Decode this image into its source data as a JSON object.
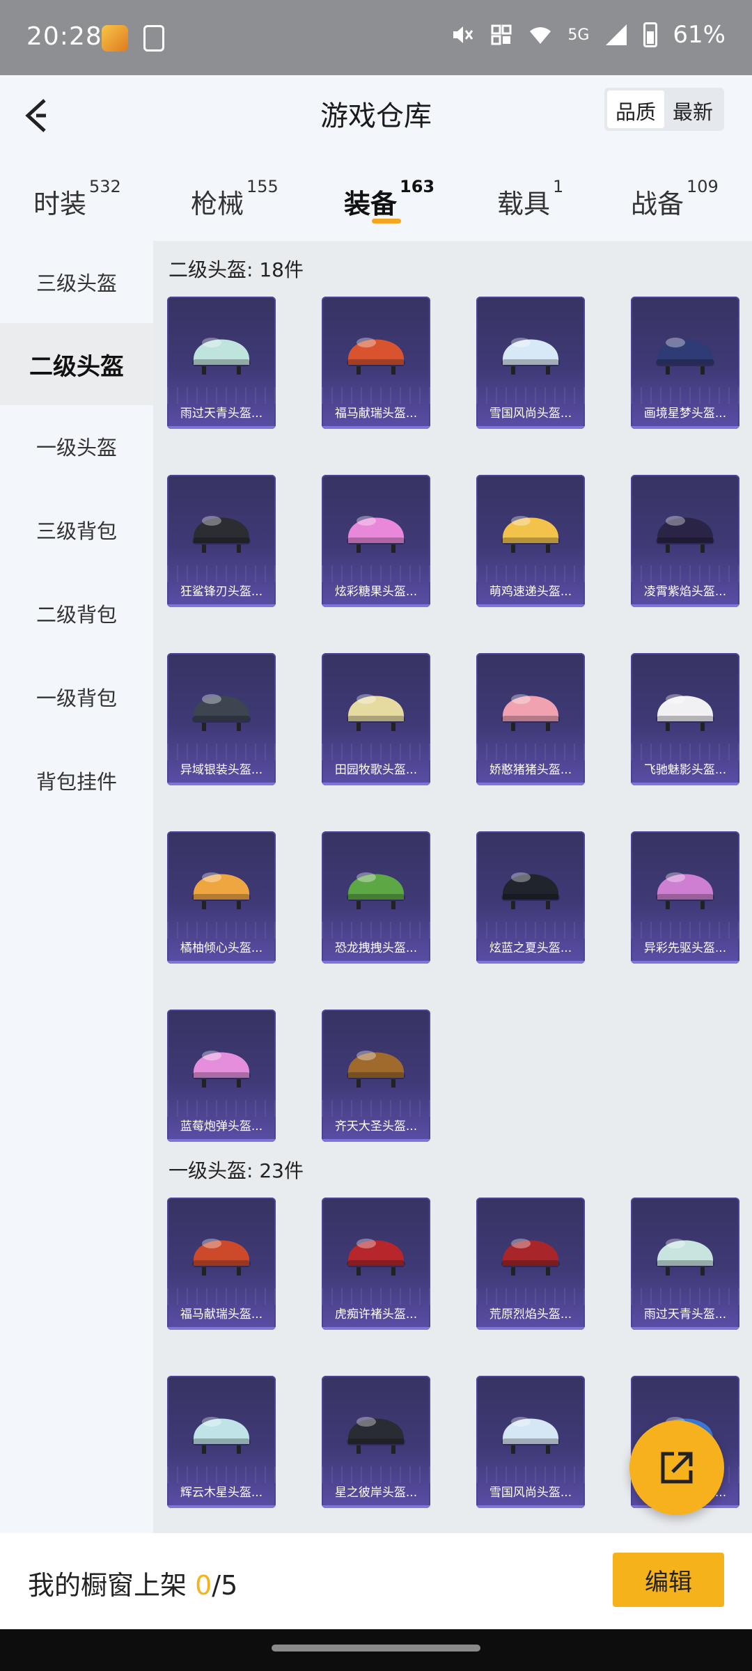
{
  "status_bar": {
    "time": "20:28",
    "network": "5G",
    "battery": "61%"
  },
  "header": {
    "title": "游戏仓库",
    "sort_options": [
      "品质",
      "最新"
    ],
    "selected_sort": "品质"
  },
  "tabs": [
    {
      "label": "时装",
      "count": "532"
    },
    {
      "label": "枪械",
      "count": "155"
    },
    {
      "label": "装备",
      "count": "163",
      "active": true
    },
    {
      "label": "载具",
      "count": "1"
    },
    {
      "label": "战备",
      "count": "109"
    }
  ],
  "sidebar": [
    {
      "label": "三级头盔"
    },
    {
      "label": "二级头盔",
      "active": true
    },
    {
      "label": "一级头盔"
    },
    {
      "label": "三级背包"
    },
    {
      "label": "二级背包"
    },
    {
      "label": "一级背包"
    },
    {
      "label": "背包挂件"
    }
  ],
  "sections": [
    {
      "title": "二级头盔: 18件",
      "items": [
        {
          "name": "雨过天青头盔...",
          "color": "#bfe3dd"
        },
        {
          "name": "福马献瑞头盔...",
          "color": "#d9532f"
        },
        {
          "name": "雪国风尚头盔...",
          "color": "#d7e8f6"
        },
        {
          "name": "画境星梦头盔...",
          "color": "#2e3b75"
        },
        {
          "name": "狂鲨锋刃头盔...",
          "color": "#2b2d33"
        },
        {
          "name": "炫彩糖果头盔...",
          "color": "#e987d9"
        },
        {
          "name": "萌鸡速递头盔...",
          "color": "#f2c24b"
        },
        {
          "name": "凌霄紫焰头盔...",
          "color": "#2a2546"
        },
        {
          "name": "异域银装头盔...",
          "color": "#3c4550"
        },
        {
          "name": "田园牧歌头盔...",
          "color": "#e5dba0"
        },
        {
          "name": "娇憨猪猪头盔...",
          "color": "#f0a2b0"
        },
        {
          "name": "飞驰魅影头盔...",
          "color": "#f1f1f4"
        },
        {
          "name": "橘柚倾心头盔...",
          "color": "#f0a640"
        },
        {
          "name": "恐龙拽拽头盔...",
          "color": "#5da844"
        },
        {
          "name": "炫蓝之夏头盔...",
          "color": "#20242c"
        },
        {
          "name": "异彩先驱头盔...",
          "color": "#cf7fd1"
        },
        {
          "name": "蓝莓炮弹头盔...",
          "color": "#e58fdc"
        },
        {
          "name": "齐天大圣头盔...",
          "color": "#a06a2c"
        }
      ]
    },
    {
      "title": "一级头盔: 23件",
      "items": [
        {
          "name": "福马献瑞头盔...",
          "color": "#cc4a2a"
        },
        {
          "name": "虎痴许褚头盔...",
          "color": "#b7262b"
        },
        {
          "name": "荒原烈焰头盔...",
          "color": "#a8252a"
        },
        {
          "name": "雨过天青头盔...",
          "color": "#c8e4df"
        },
        {
          "name": "辉云木星头盔...",
          "color": "#bfe3e6"
        },
        {
          "name": "星之彼岸头盔...",
          "color": "#2a2c34"
        },
        {
          "name": "雪国风尚头盔...",
          "color": "#d5e6f4"
        },
        {
          "name": "画境星梦头盔...",
          "color": "#3a7bd8"
        }
      ]
    }
  ],
  "bottom_bar": {
    "label": "我的橱窗上架",
    "count": "0",
    "total": "/5",
    "edit_label": "编辑"
  }
}
